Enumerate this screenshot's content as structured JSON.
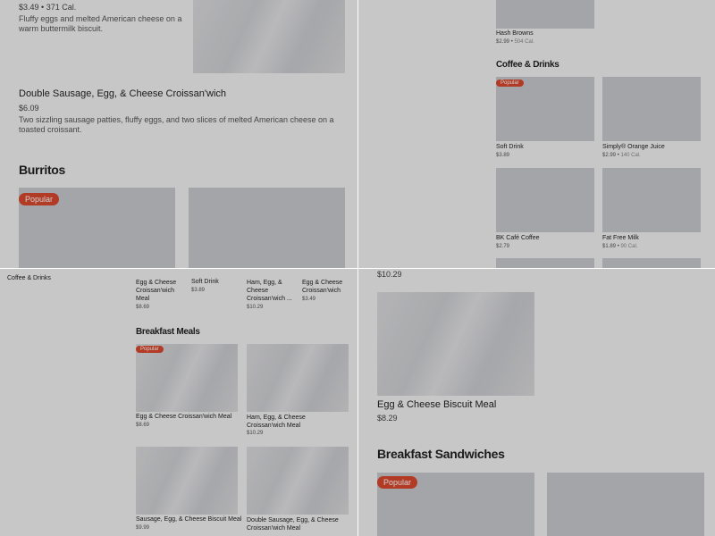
{
  "q1": {
    "item1": {
      "price": "$3.49",
      "sep": "•",
      "cal": "371 Cal.",
      "description": "Fluffy eggs and melted American cheese on a warm buttermilk biscuit."
    },
    "item2": {
      "name": "Double Sausage, Egg, & Cheese Croissan'wich",
      "price": "$6.09",
      "description": "Two sizzling sausage patties, fluffy eggs, and two slices of melted American cheese on a toasted croissant."
    },
    "section_title": "Burritos",
    "badge": "Popular"
  },
  "q2": {
    "hash_browns": {
      "name": "Hash Browns",
      "price": "$2.99",
      "sep": "•",
      "cal": "504 Cal."
    },
    "section_title": "Coffee & Drinks",
    "badge": "Popular",
    "items": [
      {
        "name": "Soft Drink",
        "price": "$3.89",
        "sep": "",
        "cal": ""
      },
      {
        "name": "Simply® Orange Juice",
        "price": "$2.99",
        "sep": "•",
        "cal": "140 Cal."
      },
      {
        "name": "BK Café Coffee",
        "price": "$2.79",
        "sep": "",
        "cal": ""
      },
      {
        "name": "Fat Free Milk",
        "price": "$1.89",
        "sep": "•",
        "cal": "90 Cal."
      }
    ]
  },
  "q3": {
    "side_label": "Coffee & Drinks",
    "top_row": [
      {
        "name": "Egg & Cheese Croissan'wich Meal",
        "price": "$8.69"
      },
      {
        "name": "Soft Drink",
        "price": "$3.89"
      },
      {
        "name": "Ham, Egg, & Cheese Croissan'wich ...",
        "price": "$10.29"
      },
      {
        "name": "Egg & Cheese Croissan'wich",
        "price": "$3.49"
      }
    ],
    "section_title": "Breakfast Meals",
    "badge": "Popular",
    "meals": [
      {
        "name": "Egg & Cheese Croissan'wich Meal",
        "price": "$8.69"
      },
      {
        "name": "Ham, Egg, & Cheese Croissan'wich Meal",
        "price": "$10.29"
      },
      {
        "name": "Sausage, Egg, & Cheese Biscuit Meal",
        "price": "$9.99"
      },
      {
        "name": "Double Sausage, Egg, & Cheese Croissan'wich Meal",
        "price": ""
      }
    ]
  },
  "q4": {
    "top_price": "$10.29",
    "item": {
      "name": "Egg & Cheese Biscuit Meal",
      "price": "$8.29"
    },
    "section_title": "Breakfast Sandwiches",
    "badge": "Popular"
  }
}
